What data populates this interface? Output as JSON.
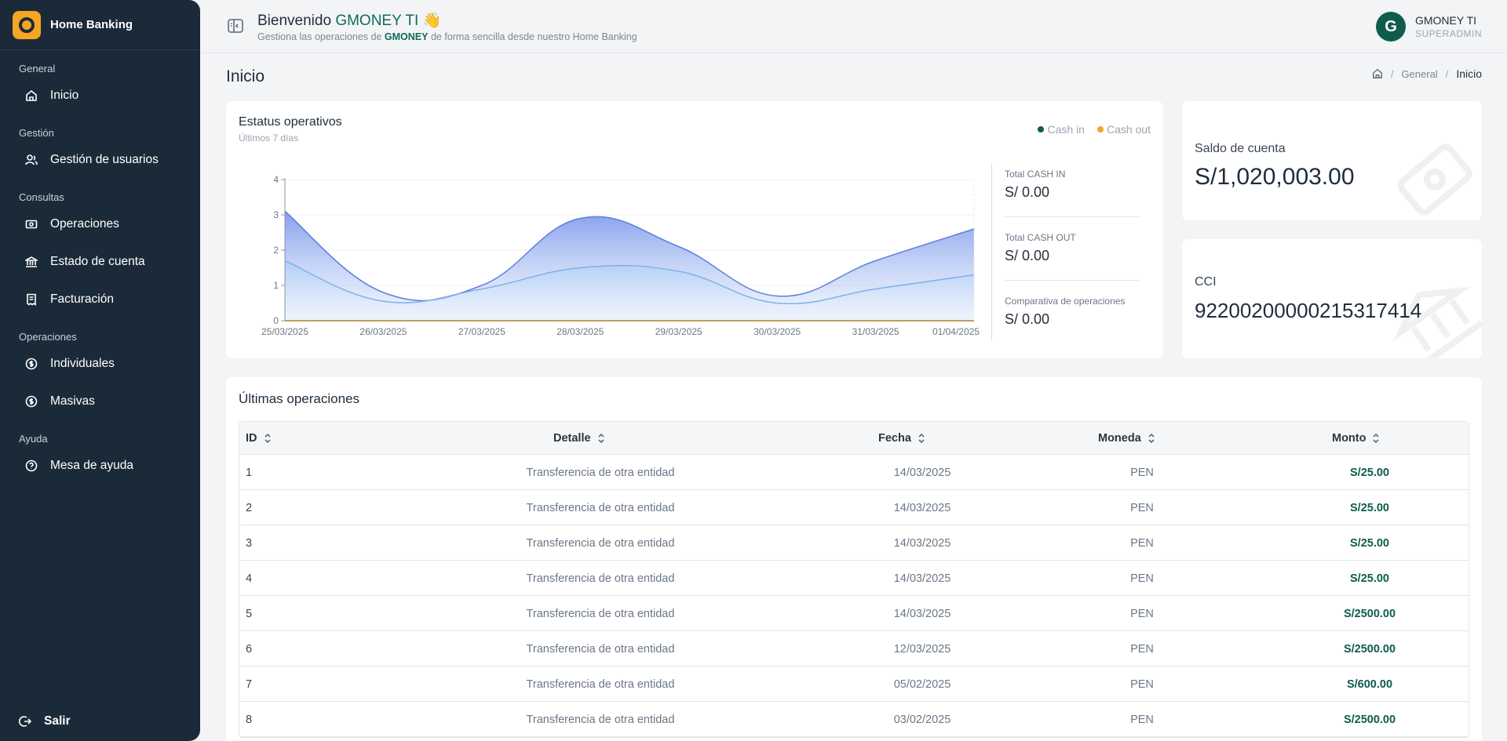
{
  "brand": {
    "name": "Home Banking"
  },
  "sidebar": {
    "sections": [
      {
        "title": "General",
        "items": [
          {
            "label": "Inicio",
            "icon": "home-icon"
          }
        ]
      },
      {
        "title": "Gestión",
        "items": [
          {
            "label": "Gestión de usuarios",
            "icon": "users-icon"
          }
        ]
      },
      {
        "title": "Consultas",
        "items": [
          {
            "label": "Operaciones",
            "icon": "cash-icon"
          },
          {
            "label": "Estado de cuenta",
            "icon": "bank-icon"
          },
          {
            "label": "Facturación",
            "icon": "invoice-icon"
          }
        ]
      },
      {
        "title": "Operaciones",
        "items": [
          {
            "label": "Individuales",
            "icon": "coin-icon"
          },
          {
            "label": "Masivas",
            "icon": "coin-icon"
          }
        ]
      },
      {
        "title": "Ayuda",
        "items": [
          {
            "label": "Mesa de ayuda",
            "icon": "help-icon"
          }
        ]
      }
    ],
    "logout_label": "Salir"
  },
  "header": {
    "welcome_prefix": "Bienvenido",
    "welcome_name": "GMONEY TI",
    "welcome_emoji": "👋",
    "subtitle_pre": "Gestiona las operaciones de",
    "subtitle_brand": "GMONEY",
    "subtitle_post": "de forma sencilla desde nuestro Home Banking",
    "user_initial": "G",
    "user_name": "GMONEY TI",
    "user_role": "SUPERADMIN"
  },
  "page": {
    "title": "Inicio",
    "breadcrumb": [
      "General",
      "Inicio"
    ]
  },
  "status_card": {
    "title": "Estatus operativos",
    "subtitle": "Últimos 7 días",
    "legend": [
      {
        "label": "Cash in",
        "color": "#0f5c4d"
      },
      {
        "label": "Cash out",
        "color": "#f5a623"
      }
    ],
    "metrics": [
      {
        "label": "Total CASH IN",
        "value": "S/ 0.00"
      },
      {
        "label": "Total CASH OUT",
        "value": "S/ 0.00"
      },
      {
        "label": "Comparativa de operaciones",
        "value": "S/ 0.00"
      }
    ]
  },
  "chart_data": {
    "type": "area",
    "x": [
      "25/03/2025",
      "26/03/2025",
      "27/03/2025",
      "28/03/2025",
      "29/03/2025",
      "30/03/2025",
      "31/03/2025",
      "01/04/2025"
    ],
    "ylim": [
      0,
      4
    ],
    "yticks": [
      "0",
      "1",
      "2",
      "3",
      "4"
    ],
    "series": [
      {
        "values": [
          3.1,
          0.8,
          1.0,
          2.9,
          2.1,
          0.7,
          1.7,
          2.6
        ],
        "color": "#5b7ee0"
      },
      {
        "values": [
          1.7,
          0.55,
          0.9,
          1.5,
          1.4,
          0.5,
          0.9,
          1.3
        ],
        "color": "#7fb0ec"
      },
      {
        "values": [
          0,
          0,
          0,
          0,
          0,
          0,
          0,
          0
        ],
        "color": "#f5a623"
      }
    ],
    "grid": true
  },
  "saldo": {
    "label": "Saldo de cuenta",
    "value": "S/1,020,003.00"
  },
  "cci": {
    "label": "CCI",
    "value": "92200200000215317414"
  },
  "operations": {
    "title": "Últimas operaciones",
    "columns": [
      "ID",
      "Detalle",
      "Fecha",
      "Moneda",
      "Monto"
    ],
    "rows": [
      [
        "1",
        "Transferencia de otra entidad",
        "14/03/2025",
        "PEN",
        "S/25.00"
      ],
      [
        "2",
        "Transferencia de otra entidad",
        "14/03/2025",
        "PEN",
        "S/25.00"
      ],
      [
        "3",
        "Transferencia de otra entidad",
        "14/03/2025",
        "PEN",
        "S/25.00"
      ],
      [
        "4",
        "Transferencia de otra entidad",
        "14/03/2025",
        "PEN",
        "S/25.00"
      ],
      [
        "5",
        "Transferencia de otra entidad",
        "14/03/2025",
        "PEN",
        "S/2500.00"
      ],
      [
        "6",
        "Transferencia de otra entidad",
        "12/03/2025",
        "PEN",
        "S/2500.00"
      ],
      [
        "7",
        "Transferencia de otra entidad",
        "05/02/2025",
        "PEN",
        "S/600.00"
      ],
      [
        "8",
        "Transferencia de otra entidad",
        "03/02/2025",
        "PEN",
        "S/2500.00"
      ]
    ]
  }
}
